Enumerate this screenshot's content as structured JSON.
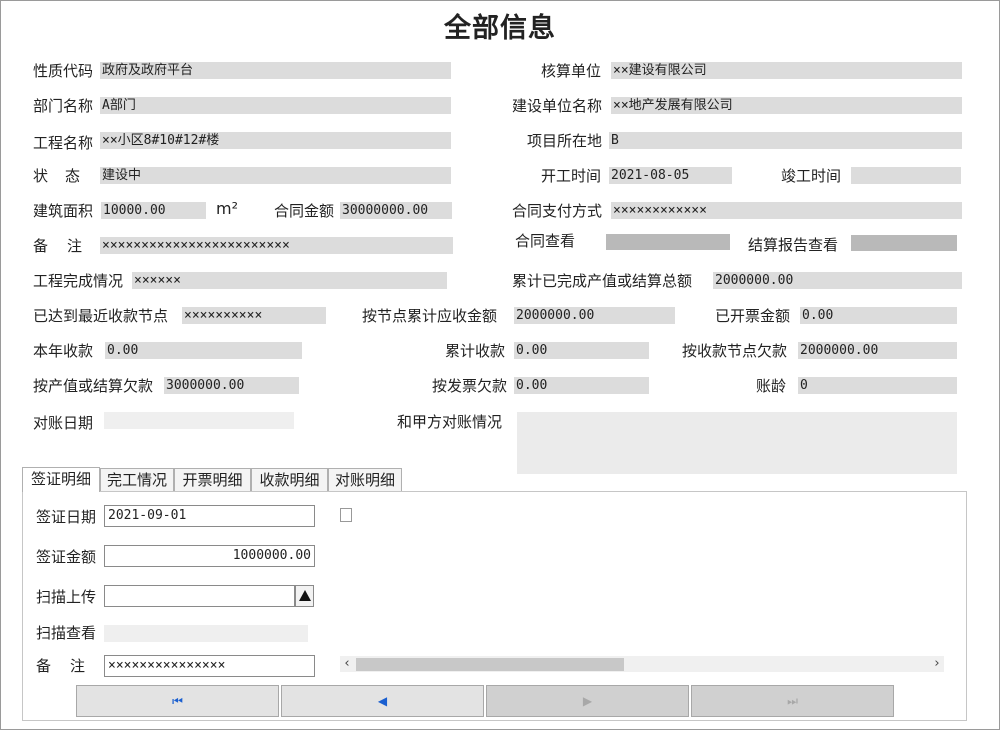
{
  "title": "全部信息",
  "fields": {
    "nature_code": {
      "label": "性质代码",
      "value": "政府及政府平台"
    },
    "accounting_unit": {
      "label": "核算单位",
      "value": "××建设有限公司"
    },
    "department": {
      "label": "部门名称",
      "value": "A部门"
    },
    "builder": {
      "label": "建设单位名称",
      "value": "××地产发展有限公司"
    },
    "project": {
      "label": "工程名称",
      "value": "××小区8#10#12#楼"
    },
    "location": {
      "label": "项目所在地",
      "value": "B"
    },
    "status": {
      "label": "状　态",
      "value": "建设中"
    },
    "start_date": {
      "label": "开工时间",
      "value": "2021-08-05"
    },
    "finish_date": {
      "label": "竣工时间",
      "value": ""
    },
    "area": {
      "label": "建筑面积",
      "value": "10000.00",
      "unit": "m²"
    },
    "contract_amount": {
      "label": "合同金额",
      "value": "30000000.00"
    },
    "payment_method": {
      "label": "合同支付方式",
      "value": "××××××××××××"
    },
    "remark": {
      "label": "备　注",
      "value": "××××××××××××××××××××××××"
    },
    "contract_view": {
      "label": "合同查看"
    },
    "report_view": {
      "label": "结算报告查看"
    },
    "completion": {
      "label": "工程完成情况",
      "value": "××××××"
    },
    "total_output": {
      "label": "累计已完成产值或结算总额",
      "value": "2000000.00"
    },
    "latest_node": {
      "label": "已达到最近收款节点",
      "value": "××××××××××"
    },
    "node_receivable": {
      "label": "按节点累计应收金额",
      "value": "2000000.00"
    },
    "invoiced": {
      "label": "已开票金额",
      "value": "0.00"
    },
    "year_received": {
      "label": "本年收款",
      "value": "0.00"
    },
    "total_received": {
      "label": "累计收款",
      "value": "0.00"
    },
    "node_arrears": {
      "label": "按收款节点欠款",
      "value": "2000000.00"
    },
    "output_arrears": {
      "label": "按产值或结算欠款",
      "value": "3000000.00"
    },
    "invoice_arrears": {
      "label": "按发票欠款",
      "value": "0.00"
    },
    "aging": {
      "label": "账龄",
      "value": "0"
    },
    "recon_date": {
      "label": "对账日期",
      "value": ""
    },
    "recon_status": {
      "label": "和甲方对账情况",
      "value": ""
    }
  },
  "tabs": [
    "签证明细",
    "完工情况",
    "开票明细",
    "收款明细",
    "对账明细"
  ],
  "visa": {
    "date": {
      "label": "签证日期",
      "value": "2021-09-01"
    },
    "amount": {
      "label": "签证金额",
      "value": "1000000.00"
    },
    "upload": {
      "label": "扫描上传",
      "value": ""
    },
    "scan_view": {
      "label": "扫描查看"
    },
    "remark": {
      "label": "备　注",
      "value": "×××××××××××××××"
    }
  },
  "nav": {
    "first": "⏮",
    "prev": "◀",
    "next": "▶",
    "last": "⏭"
  },
  "icons": {
    "first": "first-record-icon",
    "prev": "prev-record-icon",
    "next": "next-record-icon",
    "last": "last-record-icon",
    "upload": "upload-arrow-icon"
  },
  "colors": {
    "field_bg": "#dcdcdc",
    "nav_active": "#1a5fd0",
    "nav_disabled": "#a8a8a8"
  }
}
